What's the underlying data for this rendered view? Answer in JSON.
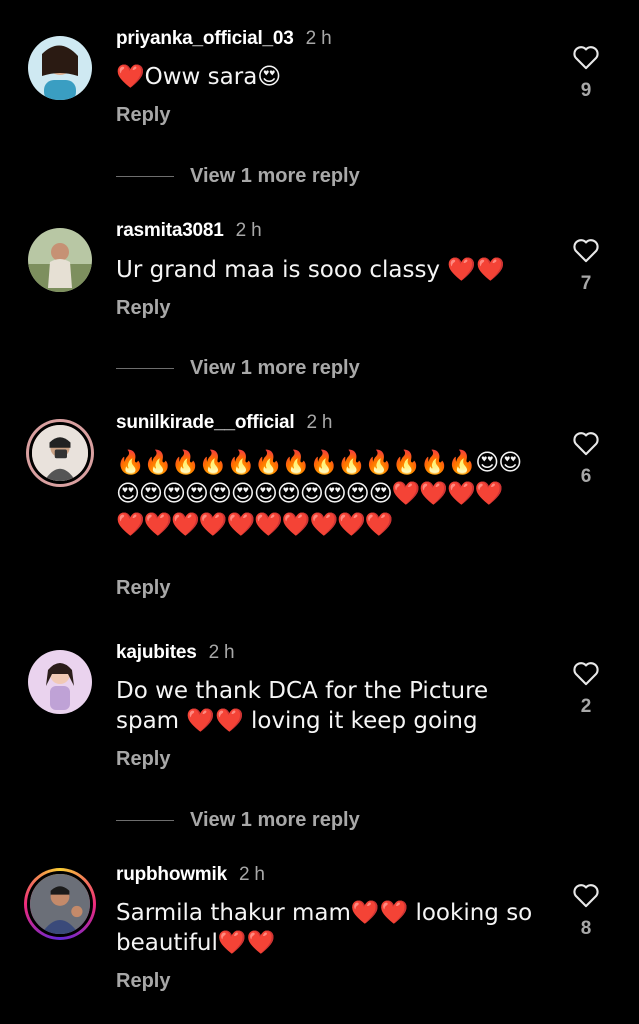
{
  "comments": [
    {
      "username": "priyanka_official_03",
      "time": "2 h",
      "text": "❤️Oww sara😍",
      "likes": "9",
      "reply_label": "Reply",
      "more_replies": "View 1 more reply"
    },
    {
      "username": "rasmita3081",
      "time": "2 h",
      "text": "Ur grand maa is sooo classy ❤️❤️",
      "likes": "7",
      "reply_label": "Reply",
      "more_replies": "View 1 more reply"
    },
    {
      "username": "sunilkirade__official",
      "time": "2 h",
      "text": "🔥🔥🔥🔥🔥🔥🔥🔥🔥🔥🔥🔥🔥😍😍😍😍😍😍😍😍😍😍😍😍😍😍❤️❤️❤️❤️❤️❤️❤️❤️❤️❤️❤️❤️❤️❤️",
      "likes": "6",
      "reply_label": "Reply"
    },
    {
      "username": "kajubites",
      "time": "2 h",
      "text": "Do we thank DCA for the Picture spam ❤️❤️ loving it keep going",
      "likes": "2",
      "reply_label": "Reply",
      "more_replies": "View 1 more reply"
    },
    {
      "username": "rupbhowmik",
      "time": "2 h",
      "text": "Sarmila thakur mam❤️❤️ looking so beautiful❤️❤️",
      "likes": "8",
      "reply_label": "Reply"
    }
  ],
  "icons": {
    "like": "heart-outline-icon"
  },
  "colors": {
    "background": "#000000",
    "secondary_text": "#a8a8a8"
  }
}
